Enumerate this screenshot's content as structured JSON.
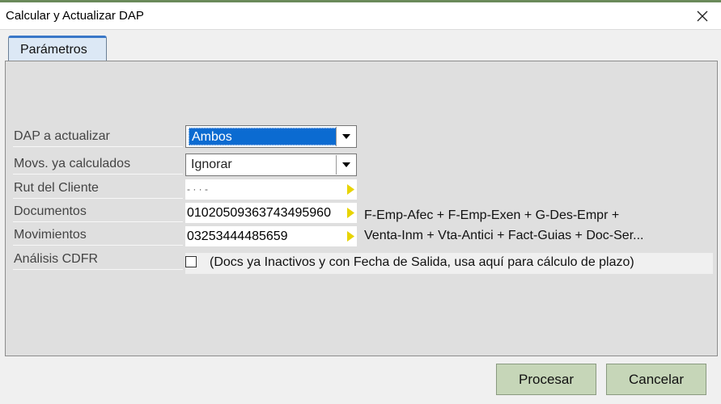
{
  "window": {
    "title": "Calcular y Actualizar DAP"
  },
  "tabs": [
    {
      "label": "Parámetros"
    }
  ],
  "fields": {
    "dap": {
      "label": "DAP a actualizar",
      "value": "Ambos"
    },
    "movs": {
      "label": "Movs. ya calculados",
      "value": "Ignorar"
    },
    "rut": {
      "label": "Rut del Cliente",
      "value": "- · · -"
    },
    "documentos": {
      "label": "Documentos",
      "value": "01020509363743495960"
    },
    "movimientos": {
      "label": "Movimientos",
      "value": "03253444485659"
    },
    "cdfr": {
      "label": "Análisis CDFR",
      "checked": false,
      "note": "(Docs ya Inactivos y con Fecha de Salida, usa aquí para cálculo de plazo)"
    }
  },
  "formula": {
    "line1": "F-Emp-Afec + F-Emp-Exen + G-Des-Empr +",
    "line2": "Venta-Inm + Vta-Antici + Fact-Guias + Doc-Ser..."
  },
  "buttons": {
    "procesar": "Procesar",
    "cancelar": "Cancelar"
  },
  "icons": {
    "close": "close-icon",
    "dropdown": "chevron-down-icon",
    "lookup": "triangle-right-icon"
  },
  "colors": {
    "button_bg": "#c6d6b8",
    "selection": "#0b6bd1",
    "tab_accent": "#3a78c8",
    "lookup_arrow": "#e8d400"
  }
}
